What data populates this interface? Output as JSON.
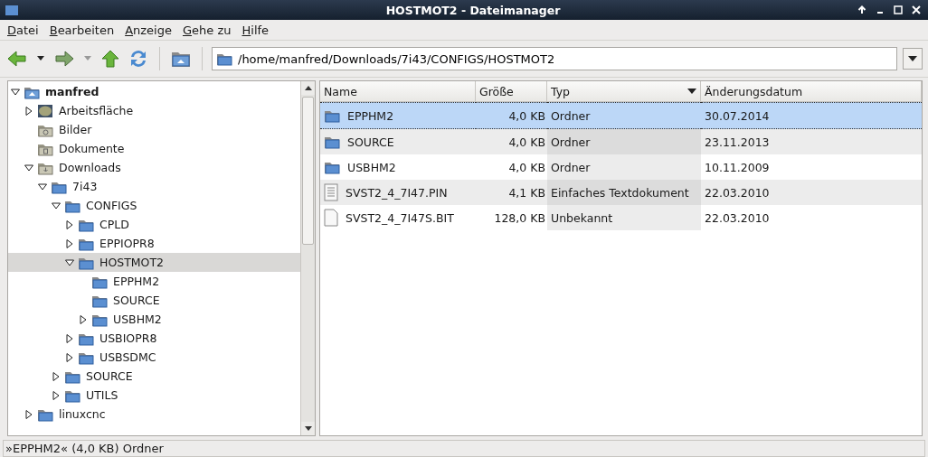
{
  "window": {
    "title": "HOSTMOT2 - Dateimanager"
  },
  "menu": [
    "Datei",
    "Bearbeiten",
    "Anzeige",
    "Gehe zu",
    "Hilfe"
  ],
  "location": {
    "value": "/home/manfred/Downloads/7i43/CONFIGS/HOSTMOT2"
  },
  "tree": [
    {
      "label": "manfred",
      "kind": "home",
      "expanded": true,
      "selected": false,
      "children": [
        {
          "label": "Arbeitsfläche",
          "kind": "desktop",
          "expanded": false,
          "selected": false
        },
        {
          "label": "Bilder",
          "kind": "pictures",
          "selected": false
        },
        {
          "label": "Dokumente",
          "kind": "documents",
          "selected": false
        },
        {
          "label": "Downloads",
          "kind": "downloads",
          "expanded": true,
          "selected": false,
          "children": [
            {
              "label": "7i43",
              "kind": "folder",
              "expanded": true,
              "selected": false,
              "children": [
                {
                  "label": "CONFIGS",
                  "kind": "folder",
                  "expanded": true,
                  "selected": false,
                  "children": [
                    {
                      "label": "CPLD",
                      "kind": "folder",
                      "expanded": false,
                      "selected": false
                    },
                    {
                      "label": "EPPIOPR8",
                      "kind": "folder",
                      "expanded": false,
                      "selected": false
                    },
                    {
                      "label": "HOSTMOT2",
                      "kind": "folder",
                      "expanded": true,
                      "selected": true,
                      "children": [
                        {
                          "label": "EPPHM2",
                          "kind": "folder",
                          "selected": false
                        },
                        {
                          "label": "SOURCE",
                          "kind": "folder",
                          "selected": false
                        },
                        {
                          "label": "USBHM2",
                          "kind": "folder",
                          "expanded": false,
                          "selected": false
                        }
                      ]
                    },
                    {
                      "label": "USBIOPR8",
                      "kind": "folder",
                      "expanded": false,
                      "selected": false
                    },
                    {
                      "label": "USBSDMC",
                      "kind": "folder",
                      "expanded": false,
                      "selected": false
                    }
                  ]
                },
                {
                  "label": "SOURCE",
                  "kind": "folder",
                  "expanded": false,
                  "selected": false
                },
                {
                  "label": "UTILS",
                  "kind": "folder",
                  "expanded": false,
                  "selected": false
                }
              ]
            }
          ]
        },
        {
          "label": "linuxcnc",
          "kind": "folder",
          "expanded": false,
          "selected": false
        }
      ]
    }
  ],
  "table": {
    "columns": [
      "Name",
      "Größe",
      "Typ",
      "Änderungsdatum"
    ],
    "rows": [
      {
        "kind": "folder",
        "name": "EPPHM2",
        "size": "4,0 KB",
        "type": "Ordner",
        "date": "30.07.2014",
        "selected": true
      },
      {
        "kind": "folder",
        "name": "SOURCE",
        "size": "4,0 KB",
        "type": "Ordner",
        "date": "23.11.2013",
        "selected": false
      },
      {
        "kind": "folder",
        "name": "USBHM2",
        "size": "4,0 KB",
        "type": "Ordner",
        "date": "10.11.2009",
        "selected": false
      },
      {
        "kind": "text",
        "name": "SVST2_4_7I47.PIN",
        "size": "4,1 KB",
        "type": "Einfaches Textdokument",
        "date": "22.03.2010",
        "selected": false
      },
      {
        "kind": "file",
        "name": "SVST2_4_7I47S.BIT",
        "size": "128,0 KB",
        "type": "Unbekannt",
        "date": "22.03.2010",
        "selected": false
      }
    ]
  },
  "status_bar": "»EPPHM2« (4,0 KB) Ordner"
}
